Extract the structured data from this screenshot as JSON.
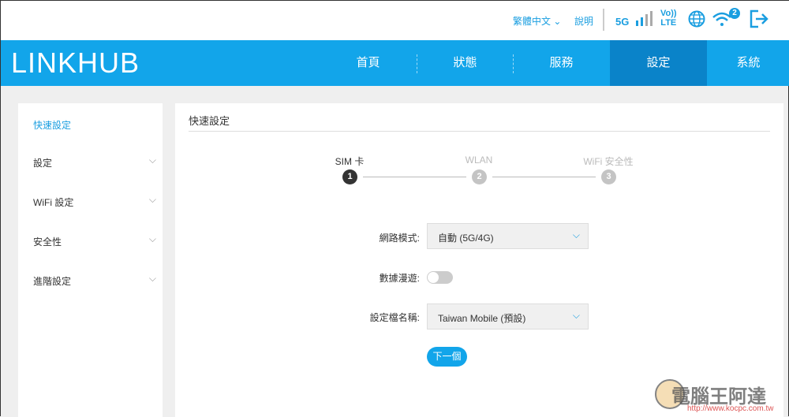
{
  "topbar": {
    "language": "繁體中文",
    "help": "說明",
    "network": "5G",
    "volte_top": "Vo))",
    "volte_bottom": "LTE",
    "wifi_clients": "2"
  },
  "nav": {
    "logo_left": "LINK",
    "logo_right": "HUB",
    "tabs": [
      {
        "label": "首頁"
      },
      {
        "label": "狀態"
      },
      {
        "label": "服務"
      },
      {
        "label": "設定",
        "active": true
      },
      {
        "label": "系統"
      }
    ]
  },
  "sidebar": {
    "items": [
      {
        "label": "快速設定",
        "active": true
      },
      {
        "label": "設定"
      },
      {
        "label": "WiFi 設定"
      },
      {
        "label": "安全性"
      },
      {
        "label": "進階設定"
      }
    ]
  },
  "main": {
    "title": "快速設定",
    "steps": [
      {
        "label": "SIM 卡",
        "number": "1",
        "active": true
      },
      {
        "label": "WLAN",
        "number": "2"
      },
      {
        "label": "WiFi 安全性",
        "number": "3"
      }
    ],
    "network_mode": {
      "label": "網路模式:",
      "value": "自動 (5G/4G)"
    },
    "roaming": {
      "label": "數據漫遊:",
      "enabled": false
    },
    "profile": {
      "label": "設定檔名稱:",
      "value": "Taiwan Mobile (預設)"
    },
    "next_button": "下一個"
  },
  "watermark": {
    "text": "電腦王阿達",
    "url": "http://www.kocpc.com.tw"
  },
  "colors": {
    "accent": "#12a5ea",
    "active_tab": "#0a83c9",
    "step_active": "#333333",
    "step_inactive": "#c4c4c4"
  }
}
